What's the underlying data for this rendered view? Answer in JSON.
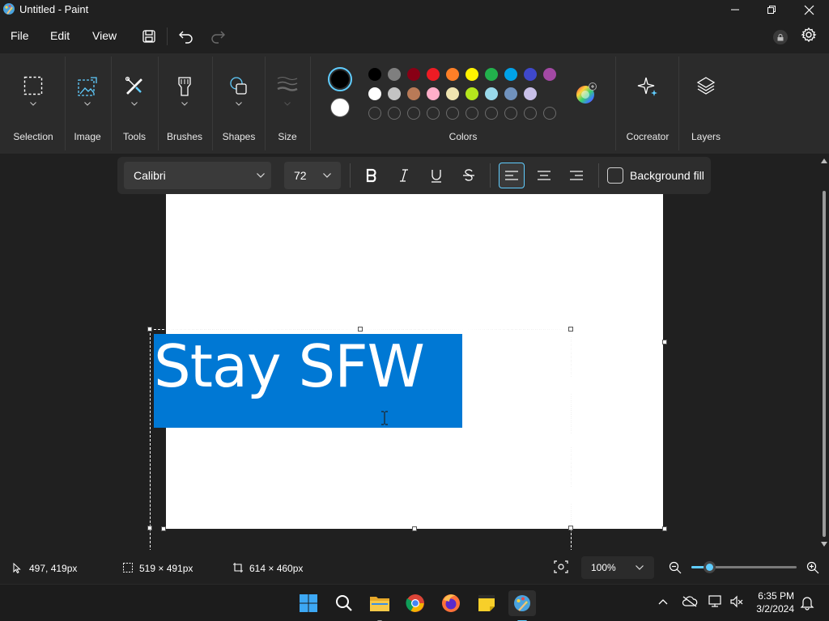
{
  "window": {
    "title": "Untitled - Paint"
  },
  "menu": {
    "file": "File",
    "edit": "Edit",
    "view": "View"
  },
  "ribbon": {
    "selection": "Selection",
    "image": "Image",
    "tools": "Tools",
    "brushes": "Brushes",
    "shapes": "Shapes",
    "size": "Size",
    "colors": "Colors",
    "cocreator": "Cocreator",
    "layers": "Layers"
  },
  "colors": {
    "primary": "#000000",
    "secondary": "#ffffff",
    "row1": [
      "#000000",
      "#7f7f7f",
      "#880015",
      "#ed1c24",
      "#ff7f27",
      "#fff200",
      "#22b14c",
      "#00a2e8",
      "#3f48cc",
      "#a349a4"
    ],
    "row2": [
      "#ffffff",
      "#c3c3c3",
      "#b97a57",
      "#ffaec9",
      "#efe4b0",
      "#b5e61d",
      "#99d9ea",
      "#7092be",
      "#c8bfe7"
    ],
    "row3_empty_count": 10
  },
  "text_toolbar": {
    "font": "Calibri",
    "font_size": "72",
    "background_fill": "Background fill",
    "background_fill_checked": false,
    "alignment": "left"
  },
  "canvas": {
    "text": "Stay SFW"
  },
  "status": {
    "cursor_pos": "497, 419px",
    "selection_size": "519 × 491px",
    "canvas_size": "614 × 460px",
    "zoom": "100%",
    "zoom_slider_fraction": 0.17
  },
  "taskbar": {
    "time": "6:35 PM",
    "date": "3/2/2024"
  }
}
